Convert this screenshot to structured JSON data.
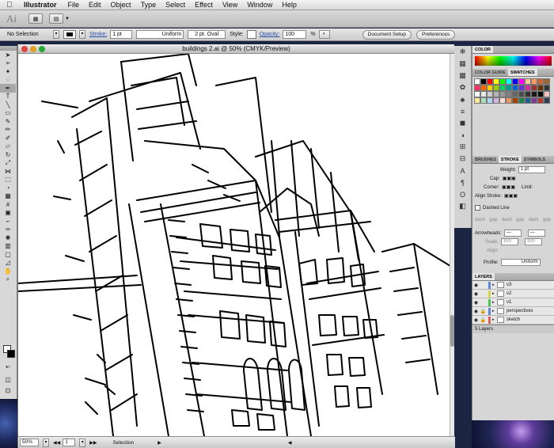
{
  "menubar": {
    "app": "Illustrator",
    "items": [
      "File",
      "Edit",
      "Object",
      "Type",
      "Select",
      "Effect",
      "View",
      "Window",
      "Help"
    ]
  },
  "appbar": {
    "logo": "Ai"
  },
  "control": {
    "selection": "No Selection",
    "stroke_label": "Stroke:",
    "stroke_weight": "1 pt",
    "profile": "Uniform",
    "brush": "2 pt. Oval",
    "style_label": "Style:",
    "opacity_label": "Opacity:",
    "opacity_value": "100",
    "opacity_unit": "%",
    "document_setup": "Document Setup",
    "preferences": "Preferences"
  },
  "document": {
    "title": "buildings 2.ai @ 50% (CMYK/Preview)",
    "zoom": "50%",
    "page": "1",
    "status": "Selection"
  },
  "panels": {
    "color_tab": "COLOR",
    "color_guide_tab": "COLOR GUIDE",
    "swatches_tab": "SWATCHES",
    "brushes_tab": "BRUSHES",
    "stroke_tab": "STROKE",
    "symbols_tab": "SYMBOLS",
    "stroke": {
      "weight_label": "Weight:",
      "weight_value": "1 pt",
      "cap_label": "Cap:",
      "corner_label": "Corner:",
      "limit_label": "Limit:",
      "align_label": "Align Stroke:",
      "dashed_line": "Dashed Line",
      "dash_labels": [
        "dash",
        "gap",
        "dash",
        "gap",
        "dash",
        "gap"
      ],
      "arrowheads_label": "Arrowheads:",
      "scale_label": "Scale:",
      "scale_a": "100",
      "scale_b": "100",
      "align2_label": "Align:",
      "profile_label": "Profile:",
      "profile_value": "Uniform"
    },
    "layers_tab": "LAYERS",
    "layers": [
      {
        "name": "v3",
        "color": "#5b86d6"
      },
      {
        "name": "v2",
        "color": "#d7d34b"
      },
      {
        "name": "v1",
        "color": "#45c24f"
      },
      {
        "name": "perspectives",
        "color": "#5b86d6"
      },
      {
        "name": "sketch",
        "color": "#e05a5a"
      }
    ],
    "layer_count": "5 Layers"
  },
  "colors": {
    "swatches": [
      "#ffffff",
      "#000000",
      "#ff0000",
      "#ffff00",
      "#00ff00",
      "#00ffff",
      "#0000ff",
      "#ff00ff",
      "#ffcc99",
      "#ff9966",
      "#cc6633",
      "#996633",
      "#ff3366",
      "#ff6600",
      "#ffcc00",
      "#99cc00",
      "#00cc66",
      "#009999",
      "#0066cc",
      "#6633cc",
      "#cc3399",
      "#993333",
      "#663300",
      "#333333",
      "#ffffff",
      "#e6e6e6",
      "#cccccc",
      "#b3b3b3",
      "#999999",
      "#808080",
      "#666666",
      "#4d4d4d",
      "#333333",
      "#1a1a1a",
      "#000000",
      "#f2c2c2",
      "#f9e79f",
      "#a9dfbf",
      "#aed6f1",
      "#d2b4de",
      "#fadbd8",
      "#e59866",
      "#a04000",
      "#1e8449",
      "#1f618d",
      "#7d3c98",
      "#b03a2e",
      "#2c3e50"
    ]
  }
}
